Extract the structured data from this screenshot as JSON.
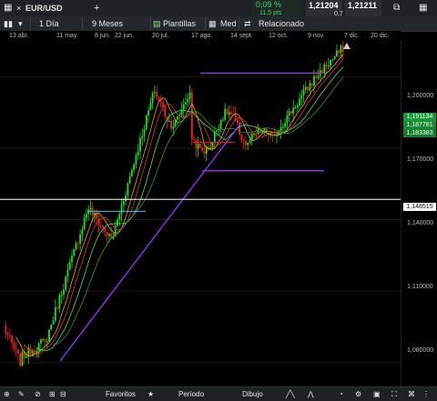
{
  "topbar": {
    "symbol": "EUR/USD",
    "add": "+",
    "change_pct": "0,09 %",
    "change_pts": "11,5 pts",
    "bid": "1,21204",
    "spread": "0,7",
    "ask": "1,21211"
  },
  "toolbar": {
    "interval": "1 Día",
    "period": "9 Meses",
    "templates": "Plantillas",
    "indicator": "Med",
    "related": "Relacionado"
  },
  "axis": {
    "x_ticks": [
      "13 abr.",
      "11 may.",
      "8 jun.",
      "22 jun.",
      "20 jul.",
      "17 ago.",
      "14 sept.",
      "12 oct.",
      "9 nov.",
      "7 dic.",
      "20 dic."
    ],
    "y_ticks": [
      "1,200000",
      "1,170000",
      "1,140000",
      "1,110000",
      "1,080000"
    ]
  },
  "price_tags": {
    "green1": "1,191134",
    "green2": "1,187781",
    "green3": "1,183383",
    "crosshair": "1,148515"
  },
  "bottombar": {
    "favorites": "Favoritos",
    "period": "Período",
    "drawing": "Dibujo"
  },
  "colors": {
    "up": "#22dd22",
    "down": "#ee2222",
    "accent_green": "#1faa3a",
    "purple": "#9a33ff",
    "cyan": "#4fb6ff"
  },
  "chart_data": {
    "type": "candlestick",
    "ylim": [
      1.07,
      1.215
    ],
    "y_ticks": [
      1.2,
      1.17,
      1.14,
      1.11,
      1.08
    ],
    "x_labels": [
      "13 abr.",
      "11 may.",
      "8 jun.",
      "22 jun.",
      "20 jul.",
      "17 ago.",
      "14 sept.",
      "12 oct.",
      "9 nov.",
      "7 dic.",
      "20 dic."
    ],
    "crosshair_y": 1.148515,
    "last_price": 1.21204
  }
}
